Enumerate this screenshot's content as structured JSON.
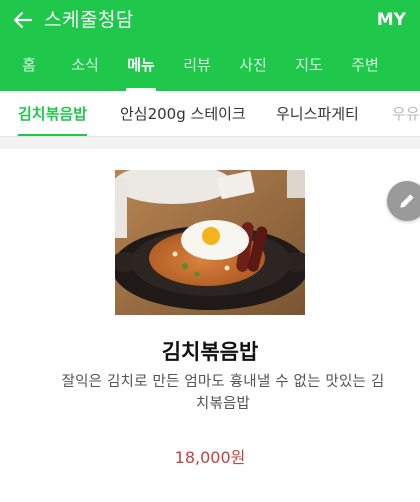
{
  "header": {
    "title": "스케줄청담",
    "back_icon": "back-arrow-icon",
    "my_label": "MY",
    "bg_color": "#1fc74a"
  },
  "tabs": [
    {
      "label": "홈"
    },
    {
      "label": "소식"
    },
    {
      "label": "메뉴",
      "active": true
    },
    {
      "label": "리뷰"
    },
    {
      "label": "사진"
    },
    {
      "label": "지도"
    },
    {
      "label": "주변"
    }
  ],
  "menu_tabs": [
    {
      "label": "김치볶음밥",
      "active": true
    },
    {
      "label": "안심200g 스테이크"
    },
    {
      "label": "우니스파게티"
    },
    {
      "label": "우유"
    }
  ],
  "menu_item": {
    "name": "김치볶음밥",
    "description": "잘익은 김치로 만든 엄마도 흉내낼 수 없는 맛있는 김치볶음밥",
    "price": "18,000원",
    "price_color": "#c4423f"
  },
  "edit_icon": "pencil-icon"
}
